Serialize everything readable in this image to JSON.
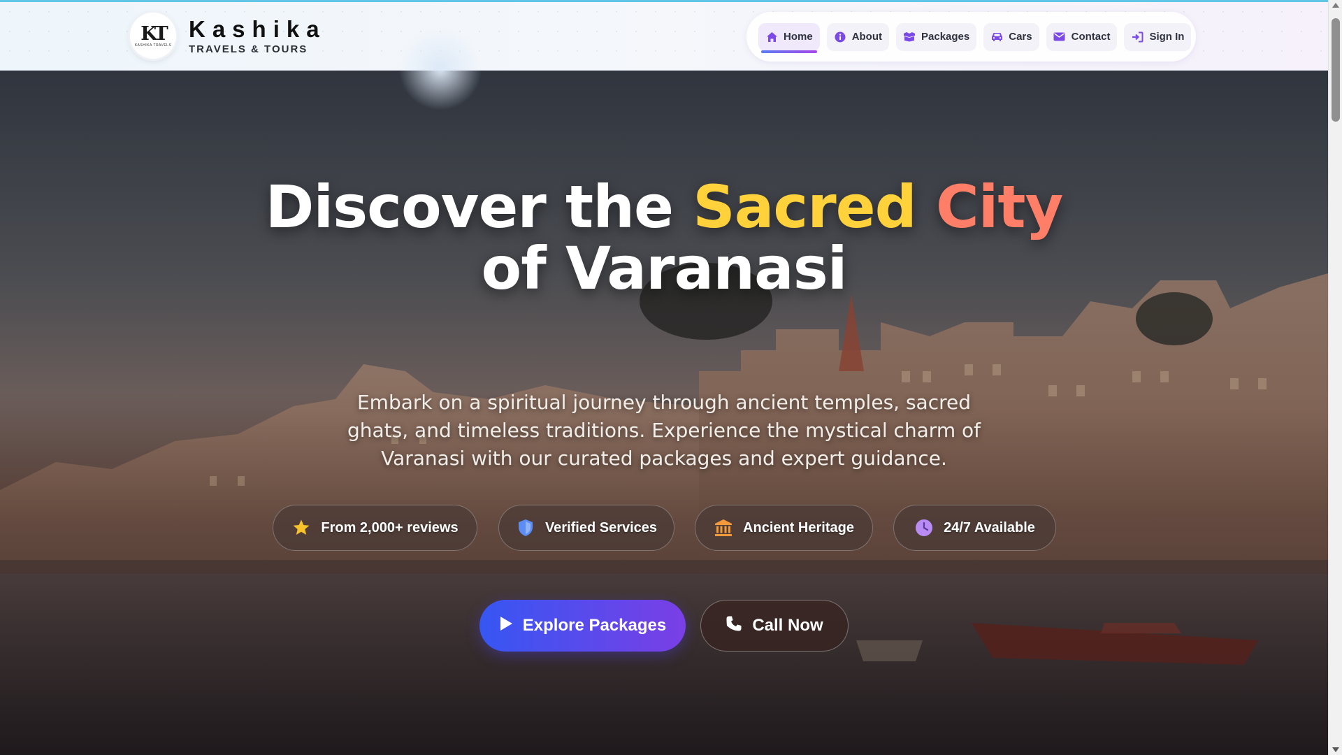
{
  "brand": {
    "logo_mark": "KT",
    "logo_small_text": "KASHIKA TRAVELS",
    "name": "Kashika",
    "tagline": "TRAVELS & TOURS"
  },
  "nav": {
    "items": [
      {
        "label": "Home",
        "icon": "home-icon",
        "active": true
      },
      {
        "label": "About",
        "icon": "info-icon",
        "active": false
      },
      {
        "label": "Packages",
        "icon": "box-icon",
        "active": false
      },
      {
        "label": "Cars",
        "icon": "car-icon",
        "active": false
      },
      {
        "label": "Contact",
        "icon": "mail-icon",
        "active": false
      },
      {
        "label": "Sign In",
        "icon": "sign-in-icon",
        "active": false
      }
    ]
  },
  "hero": {
    "title_part1": "Discover the ",
    "title_highlight1": "Sacred",
    "title_highlight2": "City",
    "title_line2": "of Varanasi",
    "subtitle": "Embark on a spiritual journey through ancient temples, sacred ghats, and timeless traditions. Experience the mystical charm of Varanasi with our curated packages and expert guidance.",
    "badges": [
      {
        "label": "From 2,000+ reviews",
        "icon": "star-icon",
        "color": "#f7c22a"
      },
      {
        "label": "Verified Services",
        "icon": "shield-icon",
        "color": "#5b8df5"
      },
      {
        "label": "Ancient Heritage",
        "icon": "landmark-icon",
        "color": "#f29a3a"
      },
      {
        "label": "24/7 Available",
        "icon": "clock-icon",
        "color": "#b98cf5"
      }
    ],
    "cta_primary": "Explore Packages",
    "cta_secondary": "Call Now"
  },
  "colors": {
    "accent_blue": "#3656f2",
    "accent_purple": "#7a3fe6",
    "highlight_yellow": "#ffd23c",
    "highlight_coral": "#ff7e67"
  }
}
